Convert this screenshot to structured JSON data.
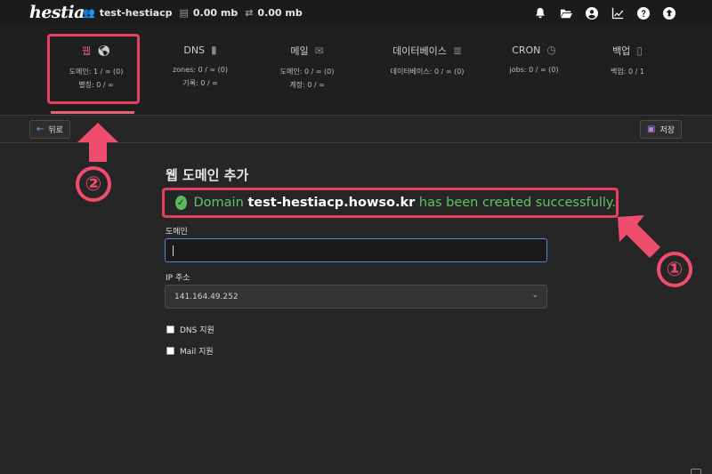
{
  "topbar": {
    "logo": "hestia",
    "user": "test-hestiacp",
    "disk": "0.00 mb",
    "bandwidth": "0.00 mb"
  },
  "tabs": [
    {
      "label": "웹",
      "icon": "globe-icon",
      "stats": [
        "도메인: 1 / ∞ (0)",
        "별칭: 0 / ∞"
      ]
    },
    {
      "label": "DNS",
      "icon": "book-icon",
      "stats": [
        "zones: 0 / ∞ (0)",
        "기록: 0 / ∞"
      ]
    },
    {
      "label": "메일",
      "icon": "mail-bulk-icon",
      "stats": [
        "도메인: 0 / ∞ (0)",
        "계정: 0 / ∞"
      ]
    },
    {
      "label": "데이터베이스",
      "icon": "database-icon",
      "stats": [
        "데이터베이스: 0 / ∞ (0)"
      ]
    },
    {
      "label": "CRON",
      "icon": "clock-icon",
      "stats": [
        "jobs: 0 / ∞ (0)"
      ]
    },
    {
      "label": "백업",
      "icon": "file-icon",
      "stats": [
        "백업: 0 / 1"
      ]
    }
  ],
  "toolbar": {
    "back_label": "뒤로",
    "save_label": "저장"
  },
  "form": {
    "title": "웹 도메인 추가",
    "alert": {
      "prefix": "Domain ",
      "domain": "test-hestiacp.howso.kr",
      "suffix": " has been created successfully."
    },
    "domain_label": "도메인",
    "domain_value": "",
    "ip_label": "IP 주소",
    "ip_value": "141.164.49.252",
    "dns_support_label": "DNS 지원",
    "mail_support_label": "Mail 지원"
  },
  "annotations": {
    "marker_1": "①",
    "marker_2": "②"
  },
  "colors": {
    "accent": "#e46277",
    "highlight": "#e83e5f",
    "success": "#62c462"
  }
}
